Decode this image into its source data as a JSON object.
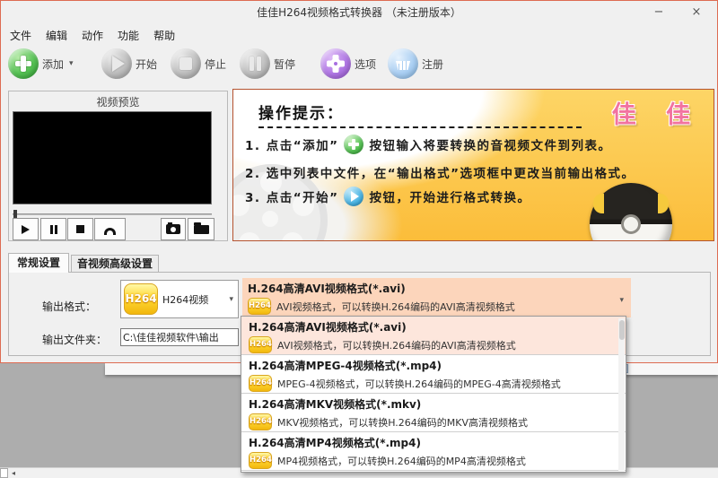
{
  "window": {
    "title": "佳佳H264视频格式转换器 （未注册版本）",
    "minimize_glyph": "−",
    "close_glyph": "×"
  },
  "menu": {
    "items": [
      {
        "label": "文件"
      },
      {
        "label": "编辑"
      },
      {
        "label": "动作"
      },
      {
        "label": "功能"
      },
      {
        "label": "帮助"
      }
    ]
  },
  "toolbar": {
    "add_label": "添加",
    "start_label": "开始",
    "stop_label": "停止",
    "pause_label": "暂停",
    "options_label": "选项",
    "register_label": "注册"
  },
  "preview": {
    "title": "视频预览"
  },
  "tips": {
    "title": "操作提示：",
    "logo": "佳 佳",
    "line1_pre": "1. 点击“添加”",
    "line1_post": "按钮输入将要转换的音视频文件到列表。",
    "line2": "2. 选中列表中文件，在“输出格式”选项框中更改当前输出格式。",
    "line3_pre": "3. 点击“开始”",
    "line3_post": "按钮，开始进行格式转换。"
  },
  "tabs": [
    {
      "label": "常规设置"
    },
    {
      "label": "音视频高级设置"
    }
  ],
  "settings": {
    "output_format_label": "输出格式：",
    "format_combo_value": "H264视频",
    "output_folder_label": "输出文件夹：",
    "output_folder_value": "C:\\佳佳视频软件\\输出"
  },
  "h264_badge": "H264",
  "format_dropdown": {
    "selected": {
      "title": "H.264高清AVI视频格式(*.avi)",
      "desc": "AVI视频格式，可以转换H.264编码的AVI高清视频格式"
    },
    "items": [
      {
        "title": "H.264高清AVI视频格式(*.avi)",
        "desc": "AVI视频格式，可以转换H.264编码的AVI高清视频格式"
      },
      {
        "title": "H.264高清MPEG-4视频格式(*.mp4)",
        "desc": "MPEG-4视频格式，可以转换H.264编码的MPEG-4高清视频格式"
      },
      {
        "title": "H.264高清MKV视频格式(*.mkv)",
        "desc": "MKV视频格式，可以转换H.264编码的MKV高清视频格式"
      },
      {
        "title": "H.264高清MP4视频格式(*.mp4)",
        "desc": "MP4视频格式，可以转换H.264编码的MP4高清视频格式"
      }
    ]
  },
  "icons": {
    "add": "plus-circle-green",
    "start": "play-circle-gray",
    "stop": "stop-circle-gray",
    "pause": "pause-circle-gray",
    "options": "gear-circle-purple",
    "register": "basket-circle-blue",
    "preview_buttons": [
      "play",
      "pause",
      "stop",
      "headphones",
      "camera",
      "folder"
    ],
    "combo_caret": "chevron-down"
  },
  "colors": {
    "window_border": "#dd6b52",
    "tips_yellow": "#fbbd3a",
    "accent_green": "#3aa03a",
    "accent_purple": "#a86fe0",
    "accent_blue": "#9cc7ef",
    "selected_peach": "#fcd5bb",
    "selected_pink": "#fde6dc",
    "badge_yellow": "#ffd935",
    "logo_pink": "#f2739f"
  }
}
